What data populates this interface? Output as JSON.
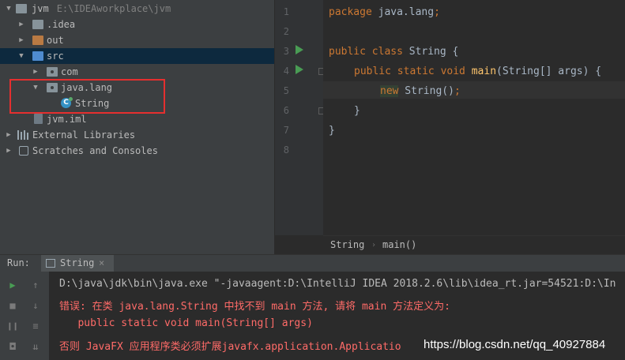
{
  "project_tree": {
    "items": [
      {
        "label": "jvm",
        "path": "E:\\IDEAworkplace\\jvm",
        "icon": "module-folder-icon",
        "arrow": "down"
      },
      {
        "label": ".idea",
        "icon": "folder-icon",
        "arrow": "right"
      },
      {
        "label": "out",
        "icon": "folder-orange-icon",
        "arrow": "right"
      },
      {
        "label": "src",
        "icon": "source-folder-icon",
        "arrow": "down"
      },
      {
        "label": "com",
        "icon": "package-icon",
        "arrow": "right"
      },
      {
        "label": "java.lang",
        "icon": "package-icon",
        "arrow": "down"
      },
      {
        "label": "String",
        "icon": "class-icon"
      },
      {
        "label": "jvm.iml",
        "icon": "iml-file-icon"
      },
      {
        "label": "External Libraries",
        "icon": "libraries-icon",
        "arrow": "right"
      },
      {
        "label": "Scratches and Consoles",
        "icon": "scratches-icon",
        "arrow": "right"
      }
    ]
  },
  "editor": {
    "line_numbers": [
      "1",
      "2",
      "3",
      "4",
      "5",
      "6",
      "7",
      "8"
    ],
    "code": {
      "l1_kw": "package",
      "l1_rest": " java.lang",
      "l1_semi": ";",
      "l3_kw": "public class",
      "l3_rest": " String {",
      "l4_kw": "public static void",
      "l4_fn": "main",
      "l4_rest": "(String[] args) {",
      "l5_kw": "new",
      "l5_rest": " String()",
      "l5_semi": ";",
      "l6": "}",
      "l7": "}"
    },
    "breadcrumb": [
      "String",
      "main()"
    ]
  },
  "run_panel": {
    "label": "Run:",
    "tab_label": "String",
    "tab_close": "×",
    "console_lines": [
      "D:\\java\\jdk\\bin\\java.exe \"-javaagent:D:\\IntelliJ IDEA 2018.2.6\\lib\\idea_rt.jar=54521:D:\\In",
      "错误: 在类 java.lang.String 中找不到 main 方法, 请将 main 方法定义为:",
      "   public static void main(String[] args)",
      "否则 JavaFX 应用程序类必须扩展javafx.application.Applicatio"
    ]
  },
  "watermark": "https://blog.csdn.net/qq_40927884",
  "colors": {
    "keyword": "#cc7832",
    "function": "#ffc66d",
    "error": "#ff6b68",
    "highlight_box": "#e52f2f",
    "selection": "#0d293e"
  }
}
